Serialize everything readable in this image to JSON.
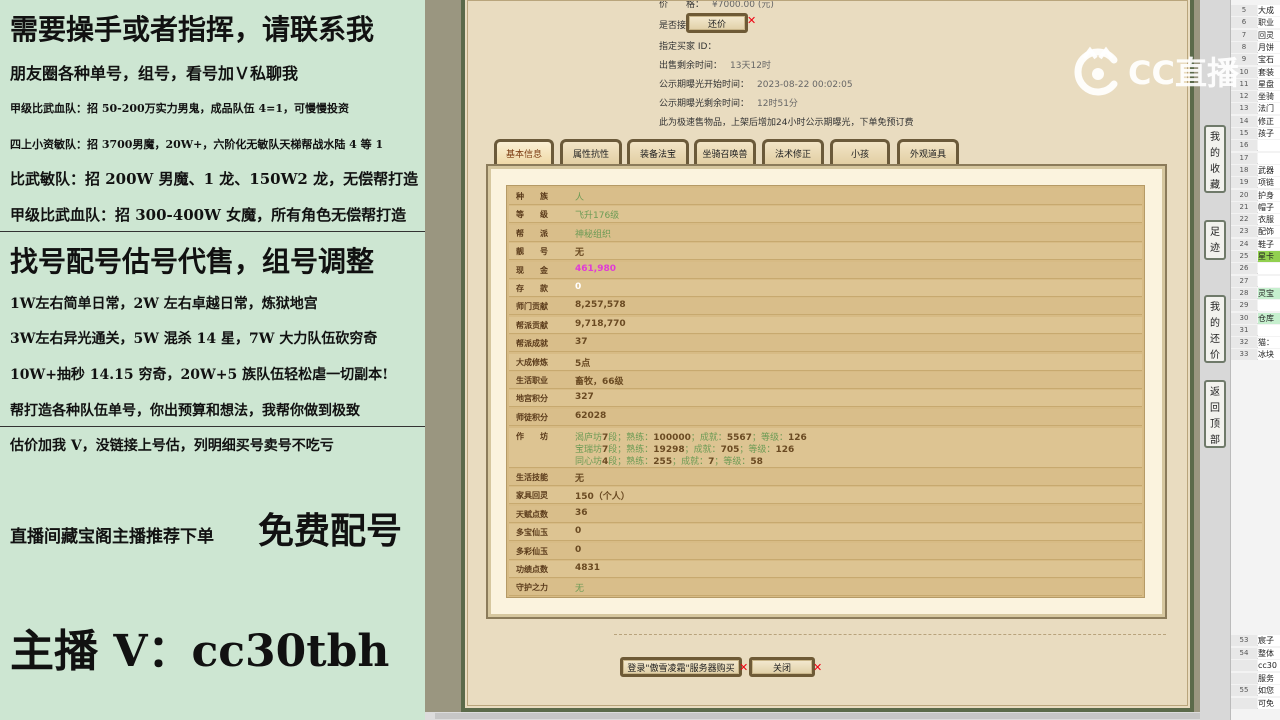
{
  "left_panel": {
    "lines": [
      "需要操手或者指挥，请联系我",
      "朋友圈各种单号，组号，看号加Ｖ私聊我",
      "甲级比武血队：招 50-200万实力男鬼，成品队伍 4=1，可慢慢投资",
      "四上小资敏队：招 3700男魔，20W+，六阶化无敏队天梯帮战水陆 4 等 1",
      "比武敏队：招 200W 男魔、1 龙、150W2 龙，无偿帮打造",
      "甲级比武血队：招 300-400W 女魔，所有角色无偿帮打造",
      "找号配号估号代售，组号调整",
      "1W左右简单日常，2W 左右卓越日常，炼狱地宫",
      "3W左右异光通关，5W 混杀 14 星，7W 大力队伍砍穷奇",
      "10W+抽秒 14.15 穷奇，20W+5 族队伍轻松虐一切副本!",
      "帮打造各种队伍单号，你出预算和想法，我帮你做到极致",
      "估价加我 V，没链接上号估，列明细买号卖号不吃亏",
      "直播间藏宝阁主播推荐下单",
      "免费配号",
      "主播 V：cc30tbh"
    ]
  },
  "game": {
    "price_label": "价　　格：",
    "price_value": "¥7000.00 (元)",
    "counter_offer_label": "是否接受还价：",
    "counter_offer_button": "还价",
    "buyer_id_label": "指定买家 ID：",
    "remaining_label": "出售剩余时间：",
    "remaining_value": "13天12时",
    "public_start_label": "公示期曝光开始时间：",
    "public_start_value": "2023-08-22 00:02:05",
    "public_remaining_label": "公示期曝光剩余时间：",
    "public_remaining_value": "12时51分",
    "notice": "此为极速售物品，上架后增加24小时公示期曝光，下单免预订费",
    "tabs": [
      "基本信息",
      "属性抗性",
      "装备法宝",
      "坐骑召唤兽",
      "法术修正",
      "小孩",
      "外观道具"
    ],
    "attributes": [
      {
        "label": "种　　族",
        "value": "人",
        "style": "v-green"
      },
      {
        "label": "等　　级",
        "value": "飞升176级",
        "style": "v-green"
      },
      {
        "label": "帮　　派",
        "value": "神秘组织",
        "style": "v-green"
      },
      {
        "label": "靓　　号",
        "value": "无",
        "style": "v-dark"
      },
      {
        "label": "现　　金",
        "value": "461,980",
        "style": "v-pink"
      },
      {
        "label": "存　　款",
        "value": "0",
        "style": "v-white"
      },
      {
        "label": "师门贡献",
        "value": "8,257,578",
        "style": "v-dark"
      },
      {
        "label": "帮派贡献",
        "value": "9,718,770",
        "style": "v-dark"
      },
      {
        "label": "帮派成就",
        "value": "37",
        "style": "v-dark"
      },
      {
        "label": "大成修炼",
        "value": "5点",
        "style": "v-dark"
      },
      {
        "label": "生活职业",
        "value": "畜牧，66级",
        "style": "v-dark"
      },
      {
        "label": "地宫积分",
        "value": "327",
        "style": "v-dark"
      },
      {
        "label": "师徒积分",
        "value": "62028",
        "style": "v-dark"
      }
    ],
    "workshop_label": "作　　坊",
    "workshops": [
      {
        "name": "渴庐坊",
        "level": "7",
        "text": "段；熟练：",
        "skill": "100000",
        "t2": "；成就：",
        "ach": "5567",
        "t3": "；等级：",
        "lv": "126"
      },
      {
        "name": "宝瑞坊",
        "level": "7",
        "text": "段；熟练：",
        "skill": "19298",
        "t2": "；成就：",
        "ach": "705",
        "t3": "；等级：",
        "lv": "126"
      },
      {
        "name": "同心坊",
        "level": "4",
        "text": "段；熟练：",
        "skill": "255",
        "t2": "；成就：",
        "ach": "7",
        "t3": "；等级：",
        "lv": "58"
      }
    ],
    "attributes_2": [
      {
        "label": "生活技能",
        "value": "无",
        "style": "v-dark"
      },
      {
        "label": "家具回灵",
        "value": "150（个人）",
        "style": "v-dark"
      },
      {
        "label": "天赋点数",
        "value": "36",
        "style": "v-dark"
      },
      {
        "label": "多宝仙玉",
        "value": "0",
        "style": "v-dark"
      },
      {
        "label": "多彩仙玉",
        "value": "0",
        "style": "v-dark"
      },
      {
        "label": "功绩点数",
        "value": "4831",
        "style": "v-dark"
      },
      {
        "label": "守护之力",
        "value": "无",
        "style": "v-green"
      }
    ],
    "login_button": "登录\"傲雪凌霜\"服务器购买",
    "close_button": "关闭"
  },
  "side_toolbar": [
    "我的收藏",
    "足迹",
    "我的还价",
    "返回顶部"
  ],
  "sheet": {
    "rows": [
      {
        "n": "5",
        "t": "大成",
        "c": ""
      },
      {
        "n": "6",
        "t": "职业",
        "c": ""
      },
      {
        "n": "7",
        "t": "回灵",
        "c": ""
      },
      {
        "n": "8",
        "t": "月饼",
        "c": ""
      },
      {
        "n": "9",
        "t": "宝石",
        "c": ""
      },
      {
        "n": "10",
        "t": "套装",
        "c": ""
      },
      {
        "n": "11",
        "t": "星盘",
        "c": ""
      },
      {
        "n": "12",
        "t": "坐骑",
        "c": ""
      },
      {
        "n": "13",
        "t": "法门",
        "c": ""
      },
      {
        "n": "14",
        "t": "修正",
        "c": ""
      },
      {
        "n": "15",
        "t": "孩子",
        "c": ""
      },
      {
        "n": "16",
        "t": "",
        "c": ""
      },
      {
        "n": "17",
        "t": "",
        "c": ""
      },
      {
        "n": "18",
        "t": "武器",
        "c": ""
      },
      {
        "n": "19",
        "t": "项链",
        "c": ""
      },
      {
        "n": "20",
        "t": "护身",
        "c": ""
      },
      {
        "n": "21",
        "t": "帽子",
        "c": ""
      },
      {
        "n": "22",
        "t": "衣服",
        "c": ""
      },
      {
        "n": "23",
        "t": "配饰",
        "c": ""
      },
      {
        "n": "24",
        "t": "鞋子",
        "c": ""
      },
      {
        "n": "25",
        "t": "星卡",
        "c": "green"
      },
      {
        "n": "26",
        "t": "",
        "c": ""
      },
      {
        "n": "27",
        "t": "",
        "c": ""
      },
      {
        "n": "28",
        "t": "灵宝",
        "c": "lgreen"
      },
      {
        "n": "29",
        "t": "",
        "c": ""
      },
      {
        "n": "30",
        "t": "仓库",
        "c": "lgreen"
      },
      {
        "n": "31",
        "t": "",
        "c": ""
      },
      {
        "n": "32",
        "t": "猫：",
        "c": ""
      },
      {
        "n": "33",
        "t": "冰块",
        "c": ""
      }
    ],
    "bottom_rows": [
      {
        "n": "53",
        "t": "宸子",
        "c": ""
      },
      {
        "n": "54",
        "t": "整体",
        "c": ""
      },
      {
        "n": "",
        "t": "cc30",
        "c": ""
      },
      {
        "n": "",
        "t": "服务",
        "c": ""
      },
      {
        "n": "55",
        "t": "如您",
        "c": ""
      },
      {
        "n": "",
        "t": "可免",
        "c": ""
      }
    ]
  },
  "watermark": {
    "text": "CC直播"
  }
}
